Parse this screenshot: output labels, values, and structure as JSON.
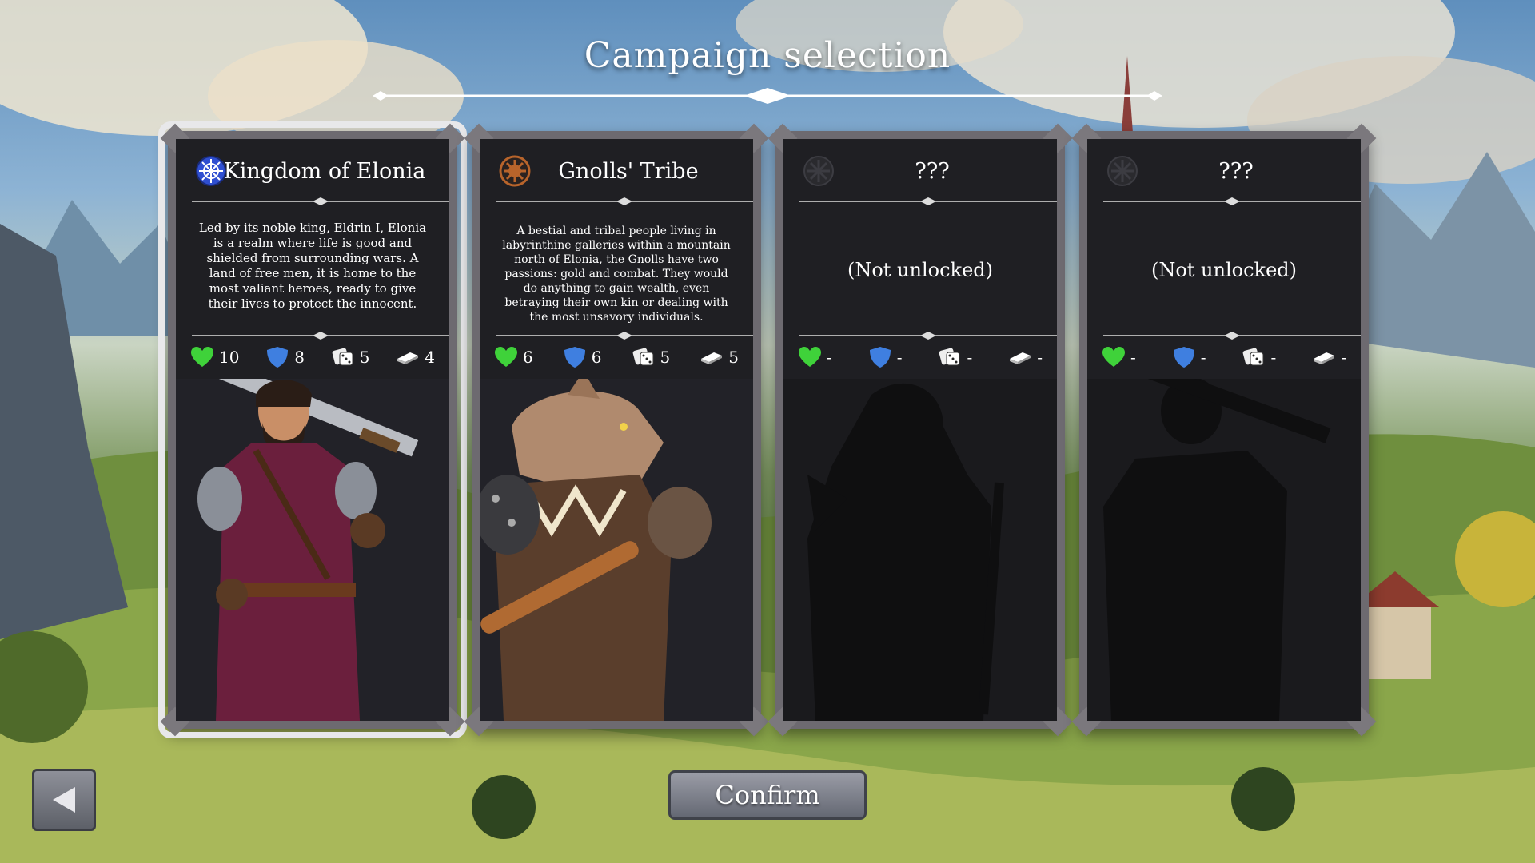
{
  "screen": {
    "title": "Campaign selection"
  },
  "cards": [
    {
      "name": "Kingdom of Elonia",
      "emblem_icon": "kingdom-emblem-icon",
      "emblem_color": "#2f4fd1",
      "selected": true,
      "description": "Led by its noble king, Eldrin I, Elonia is a realm where life is good and shielded from surrounding wars. A land of free men, it is home to the most valiant heroes, ready to give their lives to protect the innocent.",
      "stats": {
        "health": "10",
        "armor": "8",
        "dice": "5",
        "cards": "4"
      }
    },
    {
      "name": "Gnolls' Tribe",
      "emblem_icon": "gnoll-emblem-icon",
      "emblem_color": "#b8642b",
      "selected": false,
      "description": "A bestial and tribal people living in labyrinthine galleries within a mountain north of Elonia, the Gnolls have two passions: gold and combat. They would do anything to gain wealth, even betraying their own kin or dealing with the most unsavory individuals.",
      "stats": {
        "health": "6",
        "armor": "6",
        "dice": "5",
        "cards": "5"
      }
    },
    {
      "name": "???",
      "emblem_icon": "locked-emblem-icon",
      "emblem_color": "#2a2a2e",
      "selected": false,
      "locked_text": "(Not unlocked)",
      "stats": {
        "health": "-",
        "armor": "-",
        "dice": "-",
        "cards": "-"
      }
    },
    {
      "name": "???",
      "emblem_icon": "locked-emblem-icon",
      "emblem_color": "#2a2a2e",
      "selected": false,
      "locked_text": "(Not unlocked)",
      "stats": {
        "health": "-",
        "armor": "-",
        "dice": "-",
        "cards": "-"
      }
    }
  ],
  "buttons": {
    "confirm_label": "Confirm",
    "back_icon": "back-arrow-icon"
  },
  "colors": {
    "health": "#3fd23a",
    "armor": "#3f7fe0"
  }
}
